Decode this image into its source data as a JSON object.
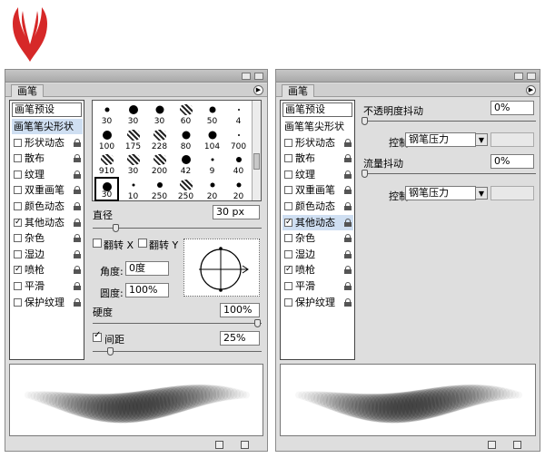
{
  "brushes_panel_1": {
    "tab": "画笔",
    "sidebar_head": "画笔预设",
    "items": [
      {
        "label": "画笔笔尖形状",
        "checkbox": false,
        "checked": false,
        "lock": false,
        "selected": true
      },
      {
        "label": "形状动态",
        "checkbox": true,
        "checked": false,
        "lock": true
      },
      {
        "label": "散布",
        "checkbox": true,
        "checked": false,
        "lock": true
      },
      {
        "label": "纹理",
        "checkbox": true,
        "checked": false,
        "lock": true
      },
      {
        "label": "双重画笔",
        "checkbox": true,
        "checked": false,
        "lock": true
      },
      {
        "label": "颜色动态",
        "checkbox": true,
        "checked": false,
        "lock": true
      },
      {
        "label": "其他动态",
        "checkbox": true,
        "checked": true,
        "lock": true
      },
      {
        "label": "杂色",
        "checkbox": true,
        "checked": false,
        "lock": true
      },
      {
        "label": "湿边",
        "checkbox": true,
        "checked": false,
        "lock": true
      },
      {
        "label": "喷枪",
        "checkbox": true,
        "checked": true,
        "lock": true
      },
      {
        "label": "平滑",
        "checkbox": true,
        "checked": false,
        "lock": true
      },
      {
        "label": "保护纹理",
        "checkbox": true,
        "checked": false,
        "lock": true
      }
    ],
    "brush_sizes": [
      "30",
      "30",
      "30",
      "60",
      "50",
      "4",
      "100",
      "175",
      "228",
      "80",
      "104",
      "700",
      "910",
      "30",
      "200",
      "42",
      "9",
      "40",
      "30",
      "10",
      "250",
      "250",
      "20",
      "20"
    ],
    "diameter_label": "直径",
    "diameter_value": "30 px",
    "flip_x": "翻转 X",
    "flip_y": "翻转 Y",
    "angle_label": "角度:",
    "angle_value": "0度",
    "roundness_label": "圆度:",
    "roundness_value": "100%",
    "hardness_label": "硬度",
    "hardness_value": "100%",
    "spacing_label": "间距",
    "spacing_value": "25%"
  },
  "brushes_panel_2": {
    "tab": "画笔",
    "sidebar_head": "画笔预设",
    "items": [
      {
        "label": "画笔笔尖形状",
        "checkbox": false,
        "checked": false,
        "lock": false
      },
      {
        "label": "形状动态",
        "checkbox": true,
        "checked": false,
        "lock": true
      },
      {
        "label": "散布",
        "checkbox": true,
        "checked": false,
        "lock": true
      },
      {
        "label": "纹理",
        "checkbox": true,
        "checked": false,
        "lock": true
      },
      {
        "label": "双重画笔",
        "checkbox": true,
        "checked": false,
        "lock": true
      },
      {
        "label": "颜色动态",
        "checkbox": true,
        "checked": false,
        "lock": true
      },
      {
        "label": "其他动态",
        "checkbox": true,
        "checked": true,
        "lock": true,
        "selected": true
      },
      {
        "label": "杂色",
        "checkbox": true,
        "checked": false,
        "lock": true
      },
      {
        "label": "湿边",
        "checkbox": true,
        "checked": false,
        "lock": true
      },
      {
        "label": "喷枪",
        "checkbox": true,
        "checked": true,
        "lock": true
      },
      {
        "label": "平滑",
        "checkbox": true,
        "checked": false,
        "lock": true
      },
      {
        "label": "保护纹理",
        "checkbox": true,
        "checked": false,
        "lock": true
      }
    ],
    "opacity_jitter_label": "不透明度抖动",
    "opacity_jitter_value": "0%",
    "control_label_1": "控制:",
    "control_value_1": "钢笔压力",
    "flow_jitter_label": "流量抖动",
    "flow_jitter_value": "0%",
    "control_label_2": "控制:",
    "control_value_2": "钢笔压力"
  },
  "colors": {
    "accent_selected": "#cfdff2",
    "logo": "#d62828"
  }
}
